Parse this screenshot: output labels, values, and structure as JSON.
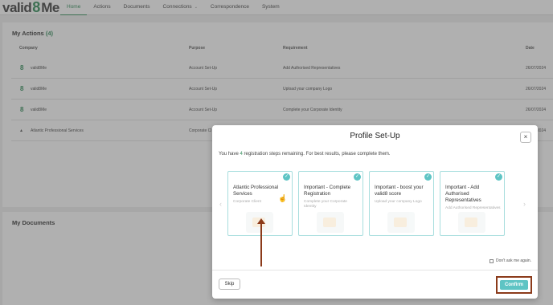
{
  "logo": {
    "part1": "valid",
    "part2": "8",
    "part3": "Me"
  },
  "nav": {
    "items": [
      {
        "label": "Home",
        "active": true
      },
      {
        "label": "Actions"
      },
      {
        "label": "Documents"
      },
      {
        "label": "Connections",
        "has_dropdown": true
      },
      {
        "label": "Correspondence"
      },
      {
        "label": "System"
      }
    ]
  },
  "actions": {
    "title": "My Actions",
    "count": "(4)",
    "columns": [
      "Company",
      "Purpose",
      "Requirement",
      "Date"
    ],
    "rows": [
      {
        "company": "valid8Me",
        "purpose": "Account Set-Up",
        "requirement": "Add Authorised Representatives",
        "date": "26/07/2024"
      },
      {
        "company": "valid8Me",
        "purpose": "Account Set-Up",
        "requirement": "Upload your company Logo",
        "date": "26/07/2024"
      },
      {
        "company": "valid8Me",
        "purpose": "Account Set-Up",
        "requirement": "Complete your Corporate Identity",
        "date": "26/07/2024"
      },
      {
        "company": "Atlantic Professional Services",
        "purpose": "Corporate Cl",
        "requirement": "",
        "date": "26/07/2024"
      }
    ]
  },
  "documents": {
    "title": "My Documents"
  },
  "modal": {
    "title": "Profile Set-Up",
    "close": "×",
    "sub_before": "You have ",
    "sub_num": "4",
    "sub_after": " registration steps remaining. For best results, please complete them.",
    "cards": [
      {
        "title": "Atlantic Professional Services",
        "subtitle": "Corporate Client"
      },
      {
        "title": "Important - Complete Registration",
        "subtitle": "Complete your Corporate Identity"
      },
      {
        "title": "Important - boost your valid8 score",
        "subtitle": "Upload your company Logo"
      },
      {
        "title": "Important - Add Authorised Representatives",
        "subtitle": "Add Authorised Representatives"
      }
    ],
    "dont_ask": "Don't ask me again.",
    "skip": "Skip",
    "confirm": "Confirm"
  },
  "colors": {
    "accent": "#2e8b57",
    "teal": "#5ec4c4",
    "annotation": "#8b3a1a"
  }
}
